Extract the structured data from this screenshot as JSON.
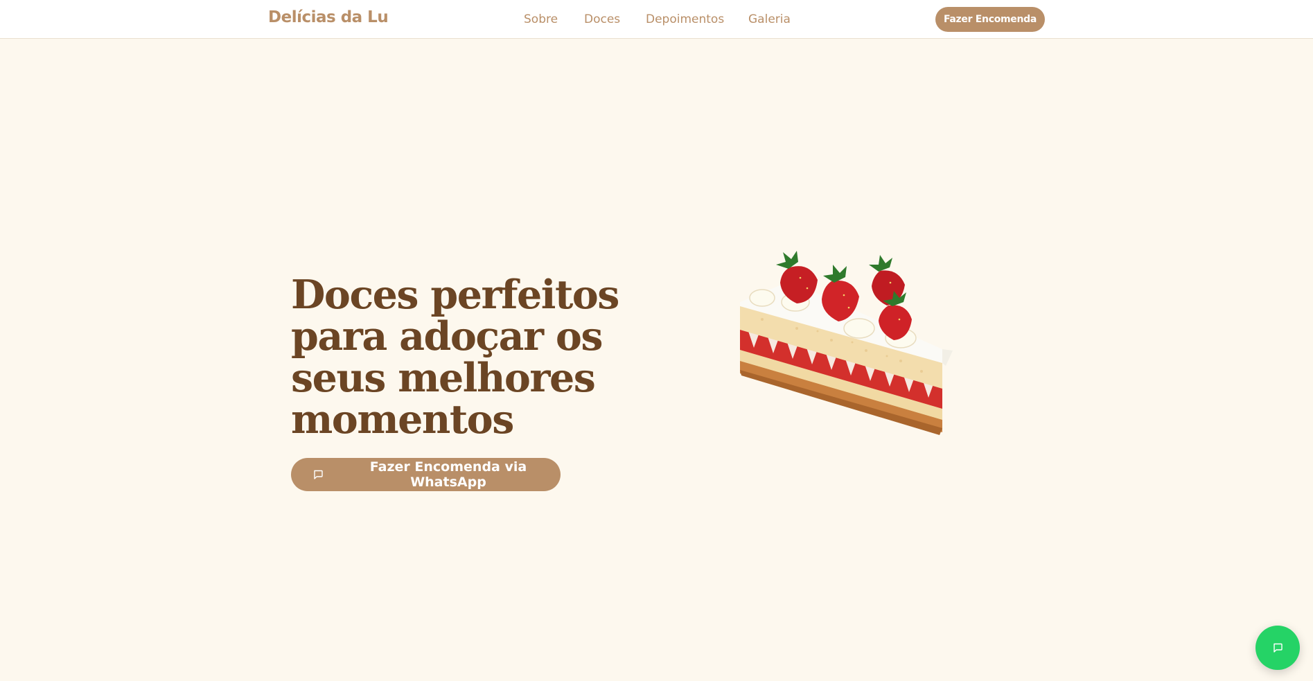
{
  "header": {
    "brand": "Delícias da Lu",
    "nav": [
      "Sobre",
      "Doces",
      "Depoimentos",
      "Galeria"
    ],
    "cta_label": "Fazer Encomenda"
  },
  "hero": {
    "title": "Doces perfeitos para adoçar os seus melhores momentos",
    "cta_label": "Fazer Encomenda via WhatsApp",
    "cta_icon": "message-icon",
    "image": "strawberry-cake-slice"
  },
  "floating_button": {
    "icon": "message-icon"
  },
  "colors": {
    "background": "#fdf8ee",
    "accent": "#b98f68",
    "heading": "#6b4524",
    "whatsapp": "#25d366"
  }
}
